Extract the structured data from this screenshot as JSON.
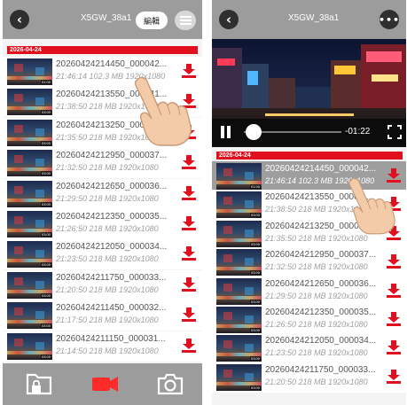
{
  "left": {
    "title": "X5GW_38a1",
    "edit_label": "編輯",
    "date_header": "2026-04-24",
    "rows": [
      {
        "name": "20260424214450_000042...",
        "meta": "21:46:14 102.3 MB 1920x1080",
        "duration": "01:00"
      },
      {
        "name": "20260424213550_000041...",
        "meta": "21:38:50 218 MB 1920x1080",
        "duration": "03:00"
      },
      {
        "name": "20260424213250_000040...",
        "meta": "21:35:50 218 MB 1920x1080",
        "duration": "03:00"
      },
      {
        "name": "20260424212950_000037...",
        "meta": "21:32:50 218 MB 1920x1080",
        "duration": "03:00"
      },
      {
        "name": "20260424212650_000036...",
        "meta": "21:29:50 218 MB 1920x1080",
        "duration": "03:00"
      },
      {
        "name": "20260424212350_000035...",
        "meta": "21:26:50 218 MB 1920x1080",
        "duration": "03:00"
      },
      {
        "name": "20260424212050_000034...",
        "meta": "21:23:50 218 MB 1920x1080",
        "duration": "03:00"
      },
      {
        "name": "20260424211750_000033...",
        "meta": "21:20:50 218 MB 1920x1080",
        "duration": "03:00"
      },
      {
        "name": "20260424211450_000032...",
        "meta": "21:17:50 218 MB 1920x1080",
        "duration": "03:00"
      },
      {
        "name": "20260424211150_000031...",
        "meta": "21:14:50 218 MB 1920x1080",
        "duration": "03:00"
      }
    ],
    "tabs": [
      "folder-lock-icon",
      "video-camera-icon",
      "camera-icon"
    ],
    "accent_color": "#e0101f"
  },
  "right": {
    "title": "X5GW_38a1",
    "more_label": "•••",
    "time_remaining": "-01:22",
    "date_header": "2026-04-24",
    "rows": [
      {
        "name": "20260424214450_000042...",
        "meta": "21:46:14 102.3 MB 1920x1080",
        "duration": "01:00"
      },
      {
        "name": "20260424213550_00004...",
        "meta": "21:38:50 218 MB 1920x1080",
        "duration": "03:00"
      },
      {
        "name": "20260424213250_00004...",
        "meta": "21:35:50 218 MB 1920x1080",
        "duration": "03:00"
      },
      {
        "name": "20260424212950_000037...",
        "meta": "21:32:50 218 MB 1920x1080",
        "duration": "03:00"
      },
      {
        "name": "20260424212650_000036...",
        "meta": "21:29:50 218 MB 1920x1080",
        "duration": "03:00"
      },
      {
        "name": "20260424212350_000035...",
        "meta": "21:26:50 218 MB 1920x1080",
        "duration": "03:00"
      },
      {
        "name": "20260424212050_000034...",
        "meta": "21:23:50 218 MB 1920x1080",
        "duration": "03:00"
      },
      {
        "name": "20260424211750_000033...",
        "meta": "21:20:50 218 MB 1920x1080",
        "duration": "03:00"
      }
    ],
    "selected_row": 0,
    "playback_progress": 0.1
  }
}
